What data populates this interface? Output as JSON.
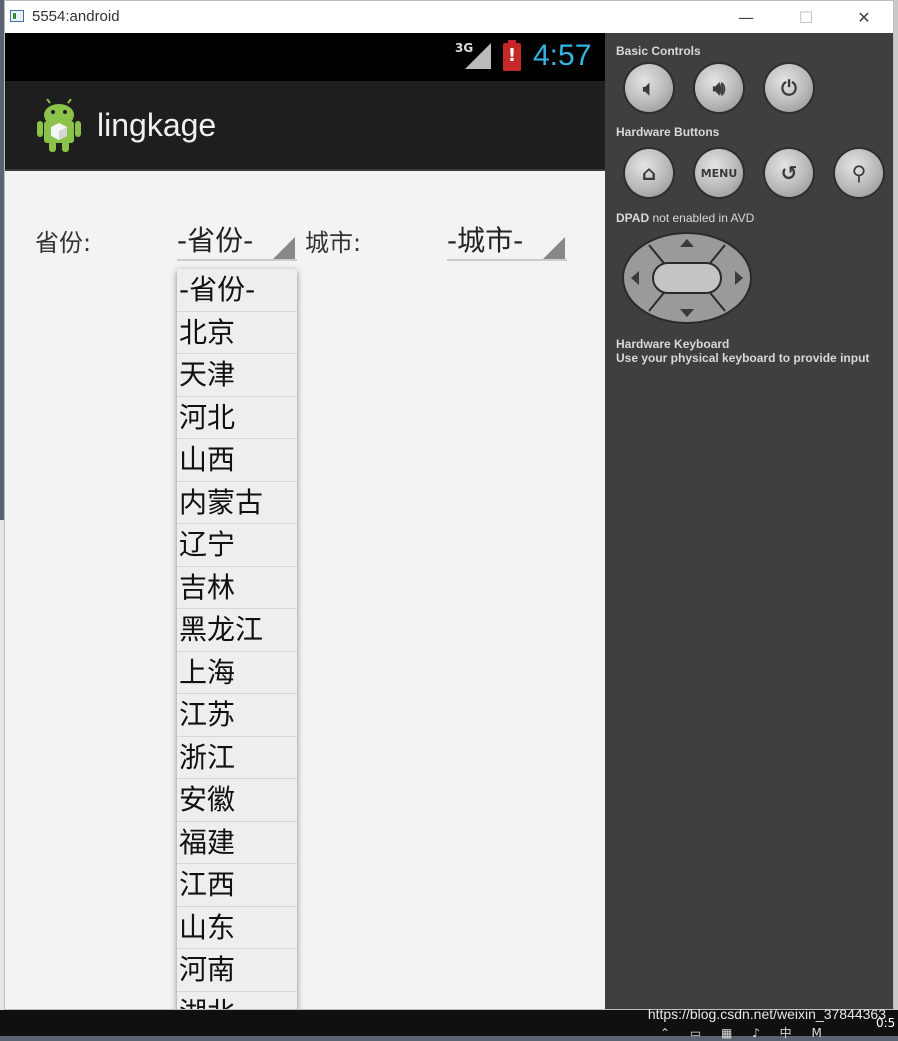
{
  "window": {
    "title": "5554:android",
    "controls": {
      "minimize": "—",
      "maximize": "☐",
      "close": "✕"
    }
  },
  "statusbar": {
    "network": "3G",
    "battery_alert": "!",
    "time": "4:57"
  },
  "actionbar": {
    "app_icon": "android-app-icon",
    "title": "lingkage"
  },
  "form": {
    "province_label": "省份:",
    "province_value": "-省份-",
    "city_label": "城市:",
    "city_value": "-城市-"
  },
  "dropdown": {
    "items": [
      "-省份-",
      "北京",
      "天津",
      "河北",
      "山西",
      "内蒙古",
      "辽宁",
      "吉林",
      "黑龙江",
      "上海",
      "江苏",
      "浙江",
      "安徽",
      "福建",
      "江西",
      "山东",
      "河南",
      "湖北"
    ]
  },
  "panel": {
    "basic_controls": "Basic Controls",
    "hardware_buttons": "Hardware Buttons",
    "menu_label": "MENU",
    "dpad_label": "DPAD",
    "dpad_note": "not enabled in AVD",
    "hardware_keyboard": "Hardware Keyboard",
    "keyboard_note": "Use your physical keyboard to provide input"
  },
  "taskbar": {
    "watermark": "https://blog.csdn.net/weixin_37844363",
    "tray_time": "0:5"
  },
  "colors": {
    "accent": "#33b5e5",
    "panel_bg": "#3f3f3f",
    "actionbar_bg": "#1e1e1e"
  }
}
